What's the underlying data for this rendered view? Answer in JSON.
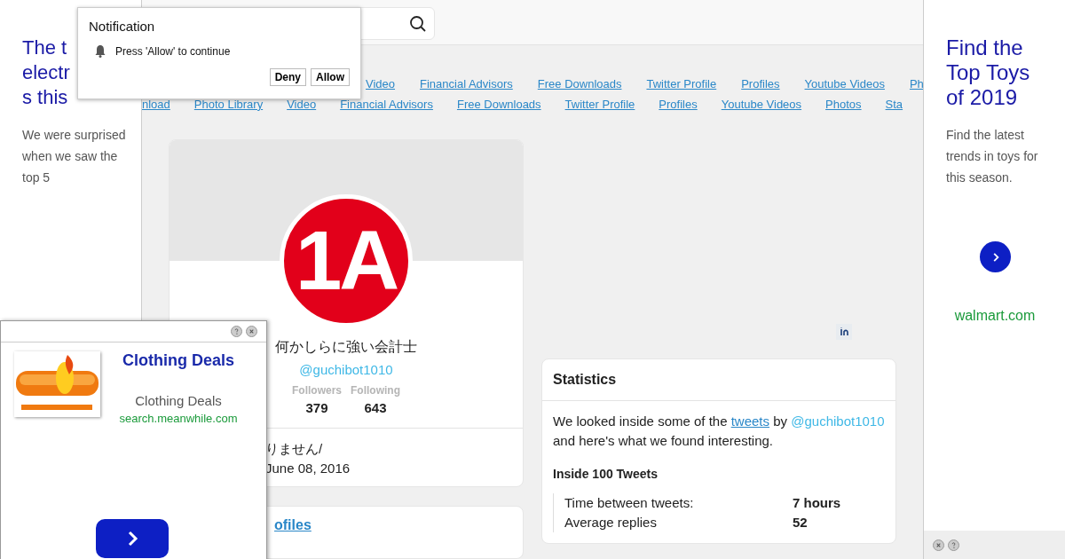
{
  "left_ad": {
    "headline_lines": [
      "The t",
      "electr",
      "s this"
    ],
    "text": "We were surprised when we saw the top 5"
  },
  "nav_rows": [
    [
      "Video",
      "Financial Advisors",
      "Free Downloads",
      "Twitter Profile",
      "Profiles",
      "Youtube Videos",
      "Ph"
    ],
    [
      "nload",
      "Photo Library",
      "Video",
      "Financial Advisors",
      "Free Downloads",
      "Twitter Profile",
      "Profiles",
      "Youtube Videos",
      "Photos",
      "Sta"
    ]
  ],
  "profile": {
    "avatar_text": "1A",
    "name": "何かしらに強い会計士",
    "handle": "@guchibot1010",
    "stats": [
      {
        "label": "Followers",
        "value": "379"
      },
      {
        "label": "Following",
        "value": "643"
      }
    ],
    "bio_lines": [
      "りません/",
      "June 08, 2016"
    ]
  },
  "profiles_link": "ofiles",
  "statistics": {
    "title": "Statistics",
    "intro": [
      {
        "kind": "text",
        "text": "We looked inside some of the "
      },
      {
        "kind": "link",
        "text": "tweets"
      },
      {
        "kind": "text",
        "text": " by "
      },
      {
        "kind": "handle",
        "text": "@guchibot1010"
      },
      {
        "kind": "text",
        "text": " and here's what we found interesting."
      }
    ],
    "section_title": "Inside 100 Tweets",
    "rows": [
      {
        "label": "Time between tweets:",
        "value": "7 hours"
      },
      {
        "label": "Average replies",
        "value": "52"
      }
    ]
  },
  "right_ad": {
    "headline": "Find the Top Toys of 2019",
    "text": "Find the latest trends in toys for this season.",
    "domain": "walmart.com"
  },
  "popup_ad": {
    "title": "Clothing Deals",
    "subtitle": "Clothing Deals",
    "domain": "search.meanwhile.com"
  },
  "notification": {
    "title": "Notification",
    "message": "Press 'Allow' to continue",
    "buttons": [
      "Deny",
      "Allow"
    ]
  }
}
